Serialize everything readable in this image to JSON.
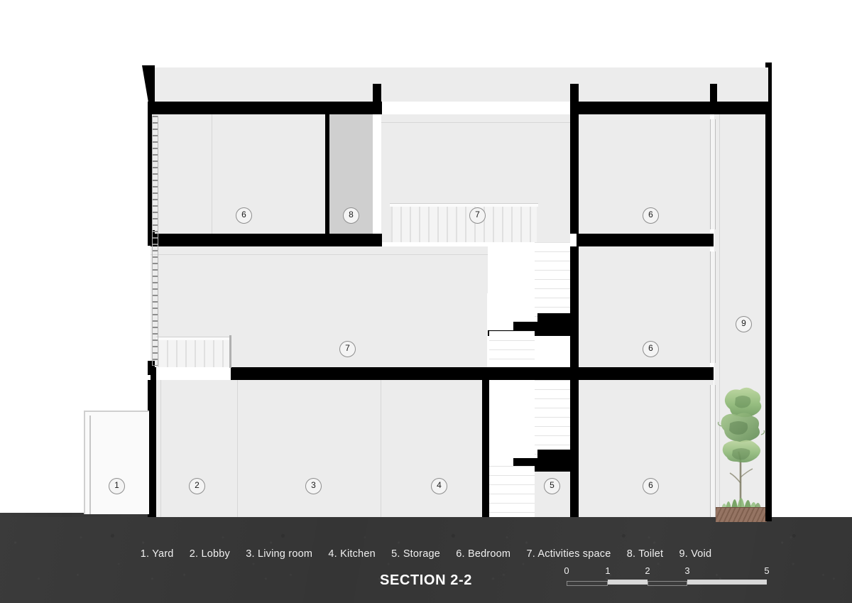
{
  "drawing": {
    "title": "SECTION 2-2",
    "legend": [
      "1. Yard",
      "2. Lobby",
      "3. Living room",
      "4. Kitchen",
      "5. Storage",
      "6. Bedroom",
      "7. Activities space",
      "8. Toilet",
      "9. Void"
    ],
    "scale_bar": {
      "labels": [
        "0",
        "1",
        "2",
        "3",
        "5"
      ]
    },
    "room_tags": [
      {
        "number": "1",
        "label": "Yard"
      },
      {
        "number": "2",
        "label": "Lobby"
      },
      {
        "number": "3",
        "label": "Living room"
      },
      {
        "number": "4",
        "label": "Kitchen"
      },
      {
        "number": "5",
        "label": "Storage"
      },
      {
        "number": "6",
        "label": "Bedroom"
      },
      {
        "number": "7",
        "label": "Activities space"
      },
      {
        "number": "6",
        "label": "Bedroom"
      },
      {
        "number": "8",
        "label": "Toilet"
      },
      {
        "number": "7",
        "label": "Activities space"
      },
      {
        "number": "6",
        "label": "Bedroom"
      },
      {
        "number": "6",
        "label": "Bedroom"
      },
      {
        "number": "9",
        "label": "Void"
      }
    ],
    "colors": {
      "paper": "#ffffff",
      "ground": "#373737",
      "poche": "#000000",
      "room_fill": "#ececec",
      "toilet_fill": "#cfcfcf",
      "planter": "#8d6a57",
      "foliage": "#8fba77",
      "text_light": "#f0f0f0"
    }
  }
}
